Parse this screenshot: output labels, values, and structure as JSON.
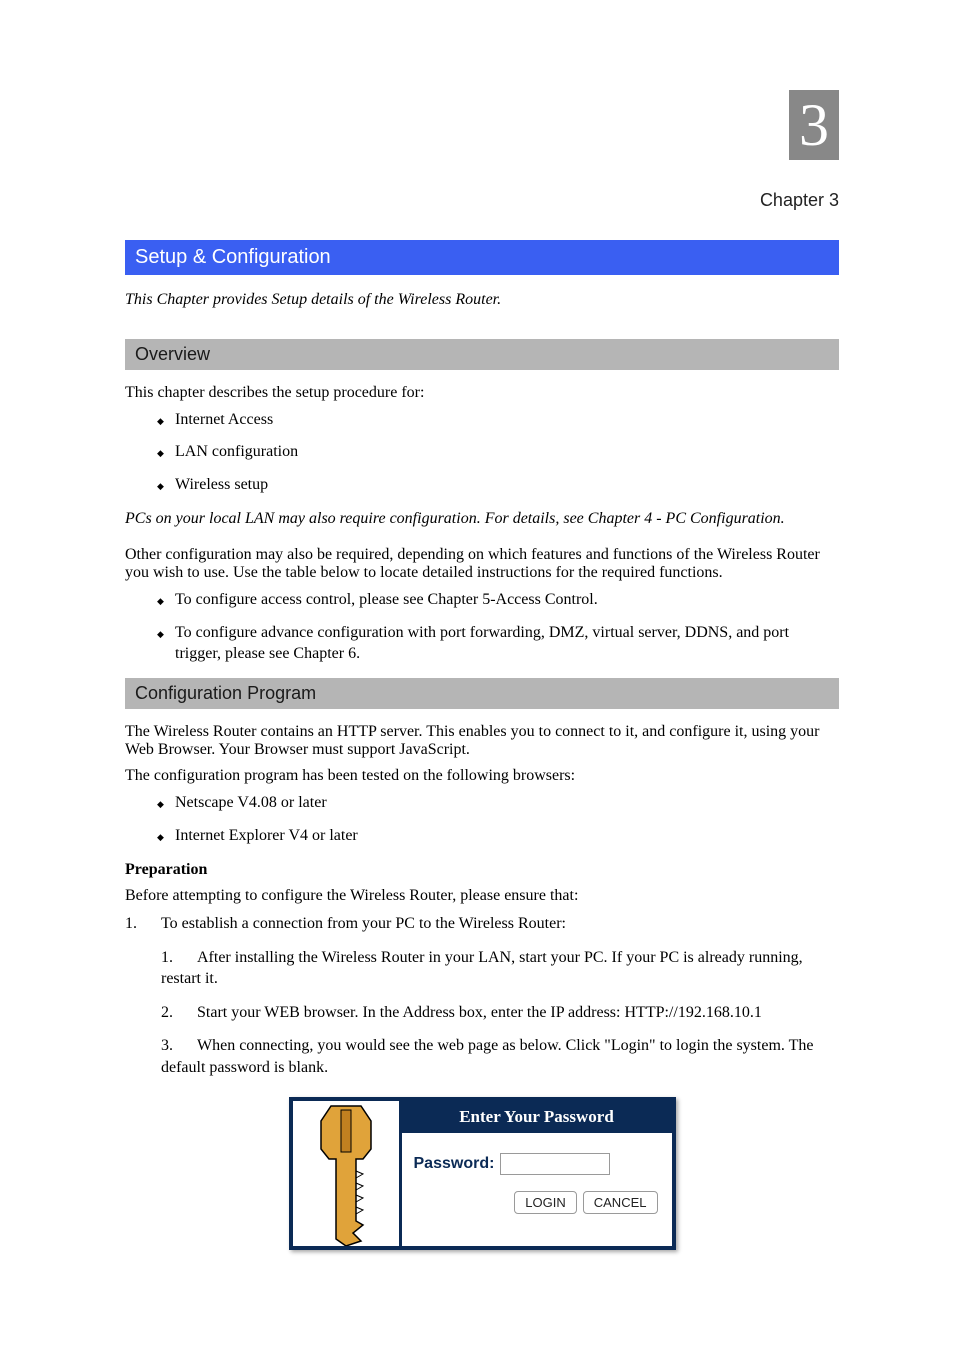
{
  "chapter": {
    "number": "3",
    "label": "Chapter 3"
  },
  "section_main": {
    "title": "Setup & Configuration",
    "intro": "This Chapter provides Setup details of the Wireless Router."
  },
  "overview": {
    "title": "Overview",
    "lead": "This chapter describes the setup procedure for:",
    "bullets": [
      "Internet Access",
      "LAN configuration",
      "Wireless setup"
    ],
    "note": "PCs on your local LAN may also require configuration. For details, see Chapter 4 - PC Configuration.",
    "lead2": "Other configuration may also be required, depending on which features and functions of the Wireless Router you wish to use. Use the table below to locate detailed instructions for the required functions.",
    "bullets2": [
      "To configure access control, please see Chapter 5-Access Control.",
      "To configure advance configuration with port forwarding, DMZ, virtual server, DDNS, and port trigger, please see Chapter 6."
    ]
  },
  "config": {
    "title": "Configuration Program",
    "para1": "The Wireless Router contains an HTTP server. This enables you to connect to it, and configure it, using your Web Browser. Your Browser must support JavaScript.",
    "para2": "The configuration program has been tested on the following browsers:",
    "bullets": [
      "Netscape V4.08 or later",
      "Internet Explorer V4 or later"
    ],
    "prep_title": "Preparation",
    "prep_text": "Before attempting to configure the Wireless Router, please ensure that:",
    "step1_num": "1.",
    "step1": "To establish a connection from your PC to the Wireless Router:",
    "step1a_num": "1.",
    "step1a": "After installing the Wireless Router in your LAN, start your PC. If your PC is already running, restart it.",
    "step1b_num": "2.",
    "step1b": "Start your WEB browser. In the Address box, enter the IP address: ",
    "step1b_url": "HTTP://192.168.10.1",
    "step1c_num": "3.",
    "step1c": "When connecting, you would see the web page as below. Click \"Login\" to login the system. The default password is blank."
  },
  "login": {
    "title": "Enter Your Password",
    "label": "Password:",
    "value": "",
    "login_button": "LOGIN",
    "cancel_button": "CANCEL"
  }
}
